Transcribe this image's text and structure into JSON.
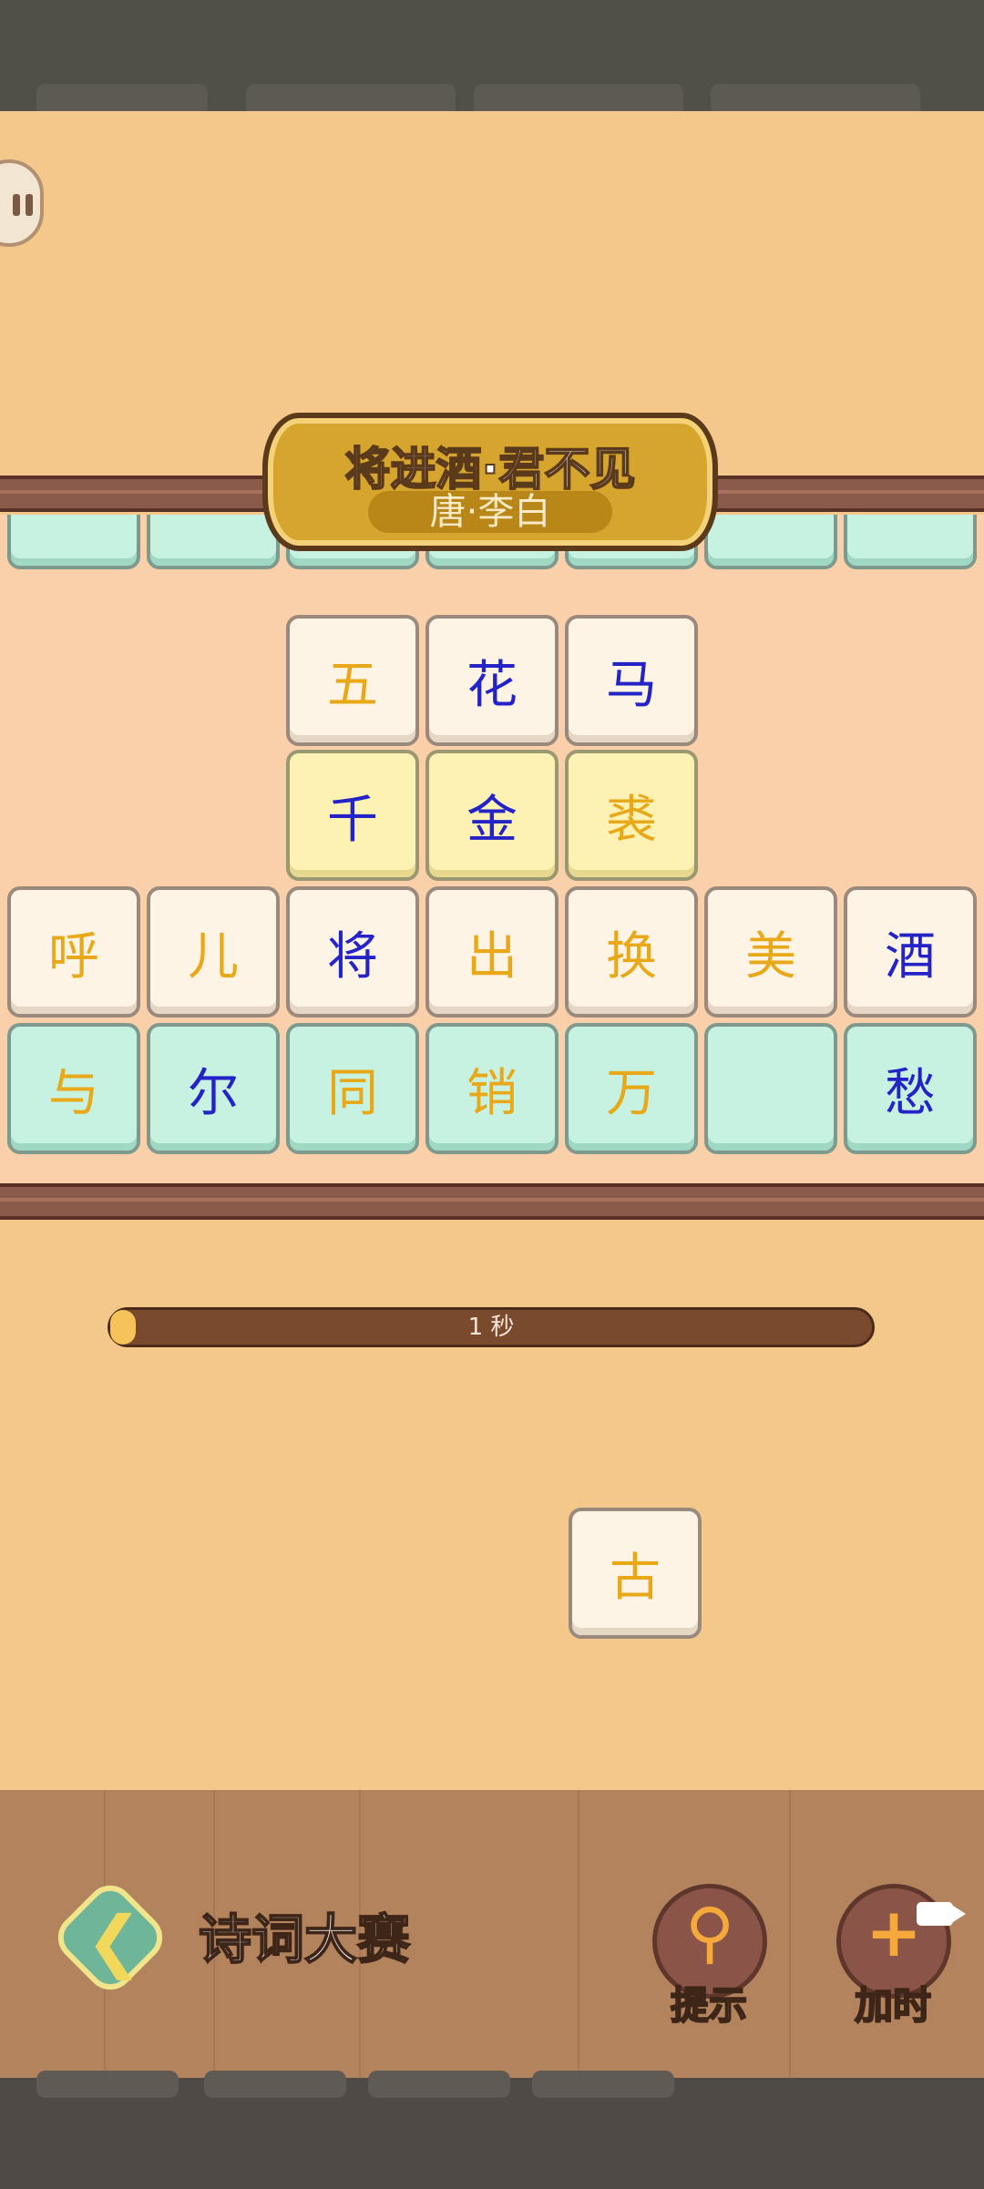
{
  "poem": {
    "title": "将进酒·君不见",
    "author": "唐·李白"
  },
  "board": {
    "rows": [
      {
        "tiles": [
          {
            "col": 2,
            "char": "五",
            "style": "cream",
            "color": "gold"
          },
          {
            "col": 3,
            "char": "花",
            "style": "cream",
            "color": "blue"
          },
          {
            "col": 4,
            "char": "马",
            "style": "cream",
            "color": "blue"
          }
        ]
      },
      {
        "tiles": [
          {
            "col": 2,
            "char": "千",
            "style": "yellow",
            "color": "blue"
          },
          {
            "col": 3,
            "char": "金",
            "style": "yellow",
            "color": "blue"
          },
          {
            "col": 4,
            "char": "裘",
            "style": "yellow",
            "color": "gold"
          }
        ]
      },
      {
        "tiles": [
          {
            "col": 0,
            "char": "呼",
            "style": "cream",
            "color": "gold"
          },
          {
            "col": 1,
            "char": "儿",
            "style": "cream",
            "color": "gold"
          },
          {
            "col": 2,
            "char": "将",
            "style": "cream",
            "color": "blue"
          },
          {
            "col": 3,
            "char": "出",
            "style": "cream",
            "color": "gold"
          },
          {
            "col": 4,
            "char": "换",
            "style": "cream",
            "color": "gold"
          },
          {
            "col": 5,
            "char": "美",
            "style": "cream",
            "color": "gold"
          },
          {
            "col": 6,
            "char": "酒",
            "style": "cream",
            "color": "blue"
          }
        ]
      },
      {
        "tiles": [
          {
            "col": 0,
            "char": "与",
            "style": "mint",
            "color": "gold"
          },
          {
            "col": 1,
            "char": "尔",
            "style": "mint",
            "color": "blue"
          },
          {
            "col": 2,
            "char": "同",
            "style": "mint",
            "color": "gold"
          },
          {
            "col": 3,
            "char": "销",
            "style": "mint",
            "color": "gold"
          },
          {
            "col": 4,
            "char": "万",
            "style": "mint",
            "color": "gold"
          },
          {
            "col": 5,
            "char": "",
            "style": "mint",
            "color": "gold"
          },
          {
            "col": 6,
            "char": "愁",
            "style": "mint",
            "color": "blue"
          }
        ]
      }
    ]
  },
  "timer": {
    "label": "1 秒",
    "progress": 0.02
  },
  "floating_tile": {
    "char": "古"
  },
  "bottom_bar": {
    "title": "诗词大赛",
    "hint_label": "提示",
    "add_time_label": "加时"
  },
  "colors": {
    "blue": "#2323c8",
    "gold": "#e8a817",
    "panel": "#f3c88a"
  },
  "icons": [
    "pause-icon",
    "back-arrow-icon",
    "magnifier-icon",
    "plus-icon",
    "video-icon"
  ]
}
